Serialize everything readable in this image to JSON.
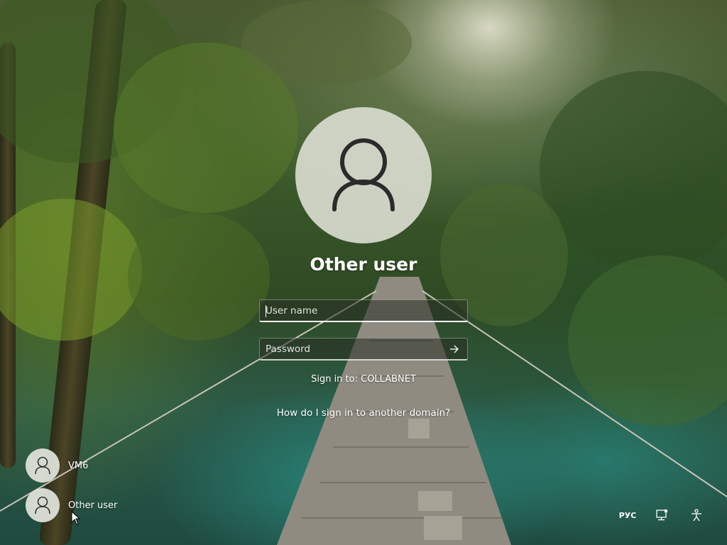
{
  "login": {
    "user_title": "Other user",
    "username_placeholder": "User name",
    "password_placeholder": "Password",
    "sign_in_to": "Sign in to: COLLABNET",
    "domain_link": "How do I sign in to another domain?"
  },
  "user_tiles": [
    {
      "label": "VM6",
      "icon": "user-icon"
    },
    {
      "label": "Other user",
      "icon": "user-icon"
    }
  ],
  "tray": {
    "language": "РУС",
    "network_icon": "network-icon",
    "accessibility_icon": "accessibility-icon"
  },
  "colors": {
    "text": "#ffffff",
    "avatar_bg": "#d7dacd",
    "user_glyph": "#2b2b2b"
  }
}
